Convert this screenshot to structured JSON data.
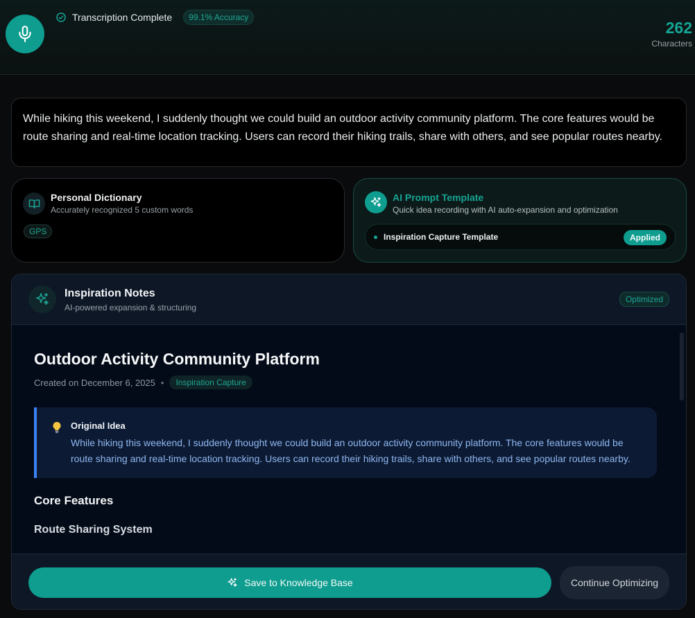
{
  "header": {
    "status_text": "Transcription Complete",
    "accuracy": "99.1% Accuracy",
    "char_count": "262",
    "char_label": "Characters"
  },
  "transcript": {
    "text": "While hiking this weekend, I suddenly thought we could build an outdoor activity community platform. The core features would be route sharing and real-time location tracking. Users can record their hiking trails, share with others, and see popular routes nearby."
  },
  "dictionary": {
    "title": "Personal Dictionary",
    "subtitle": "Accurately recognized 5 custom words",
    "tag": "GPS"
  },
  "template": {
    "title": "AI Prompt Template",
    "subtitle": "Quick idea recording with AI auto-expansion and optimization",
    "name": "Inspiration Capture Template",
    "badge": "Applied"
  },
  "notes": {
    "title": "Inspiration Notes",
    "subtitle": "AI-powered expansion & structuring",
    "badge": "Optimized",
    "doc_title": "Outdoor Activity Community Platform",
    "created": "Created on December 6, 2025",
    "meta_dot": "•",
    "category": "Inspiration Capture",
    "idea_title": "Original Idea",
    "idea_text": "While hiking this weekend, I suddenly thought we could build an outdoor activity community platform. The core features would be route sharing and real-time location tracking. Users can record their hiking trails, share with others, and see popular routes nearby.",
    "heading_core": "Core Features",
    "heading_route": "Route Sharing System",
    "save_label": "Save to Knowledge Base",
    "continue_label": "Continue Optimizing"
  },
  "icons": {
    "mic": "microphone-icon",
    "check": "check-circle-icon",
    "book": "book-open-icon",
    "sparkle": "sparkles-icon",
    "bulb": "lightbulb-icon"
  },
  "colors": {
    "accent": "#0e9d8f",
    "accent_text": "#16a594",
    "quote_border": "#3b82f6",
    "quote_text": "#8fb8f0"
  }
}
